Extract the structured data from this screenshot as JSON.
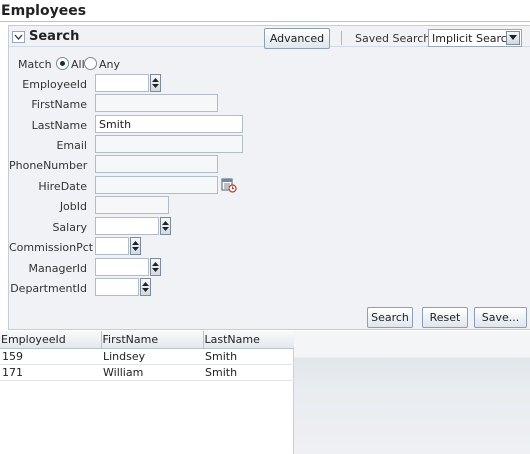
{
  "page": {
    "title": "Employees"
  },
  "search_panel": {
    "title": "Search",
    "advanced_label": "Advanced",
    "saved_search_label": "Saved Search",
    "saved_search_value": "Implicit Search",
    "match": {
      "label": "Match",
      "options": [
        "All",
        "Any"
      ],
      "selected": "All"
    },
    "fields": [
      {
        "label": "EmployeeId",
        "value": ""
      },
      {
        "label": "FirstName",
        "value": ""
      },
      {
        "label": "LastName",
        "value": "Smith"
      },
      {
        "label": "Email",
        "value": ""
      },
      {
        "label": "PhoneNumber",
        "value": ""
      },
      {
        "label": "HireDate",
        "value": ""
      },
      {
        "label": "JobId",
        "value": ""
      },
      {
        "label": "Salary",
        "value": ""
      },
      {
        "label": "CommissionPct",
        "value": ""
      },
      {
        "label": "ManagerId",
        "value": ""
      },
      {
        "label": "DepartmentId",
        "value": ""
      }
    ],
    "buttons": {
      "search": "Search",
      "reset": "Reset",
      "save": "Save..."
    }
  },
  "results": {
    "columns": [
      "EmployeeId",
      "FirstName",
      "LastName"
    ],
    "rows": [
      [
        "159",
        "Lindsey",
        "Smith"
      ],
      [
        "171",
        "William",
        "Smith"
      ]
    ]
  },
  "icons": {
    "disclosure": "chevron-down-icon",
    "select_arrow": "dropdown-arrow-icon",
    "date": "calendar-icon",
    "spinner": "spinner-arrows-icon"
  }
}
